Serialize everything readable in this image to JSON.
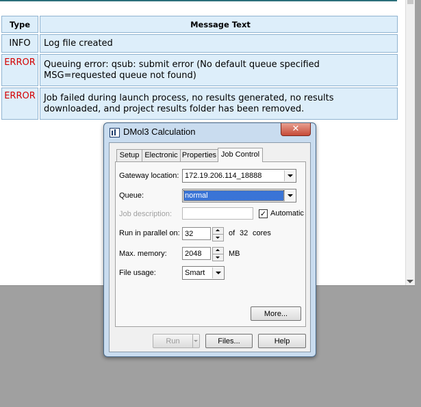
{
  "log": {
    "headers": {
      "type": "Type",
      "message": "Message Text"
    },
    "rows": [
      {
        "type": "INFO",
        "message": "Log file created"
      },
      {
        "type": "ERROR",
        "message_line1": "Queuing error: qsub: submit error (No default queue specified",
        "message_line2": "MSG=requested queue not found)"
      },
      {
        "type": "ERROR",
        "message_line1": "Job failed during launch process, no results generated, no results",
        "message_line2": "downloaded, and project results folder has been removed."
      }
    ],
    "colors": {
      "error": "#d40000",
      "cell_bg": "#ddeefa",
      "cell_border": "#8fb3d0"
    }
  },
  "dialog": {
    "title": "DMol3 Calculation",
    "close_label": "✕",
    "tabs": [
      "Setup",
      "Electronic",
      "Properties",
      "Job Control"
    ],
    "active_tab": "Job Control",
    "gateway": {
      "label": "Gateway location:",
      "value": "172.19.206.114_18888"
    },
    "queue": {
      "label": "Queue:",
      "value": "normal"
    },
    "job_description": {
      "label": "Job description:",
      "value": "",
      "automatic_label": "Automatic",
      "automatic_checked": "✓"
    },
    "parallel": {
      "label": "Run in parallel on:",
      "value": "32",
      "of_label": "of",
      "total": "32",
      "cores_label": "cores"
    },
    "memory": {
      "label": "Max. memory:",
      "value": "2048",
      "unit": "MB"
    },
    "file_usage": {
      "label": "File usage:",
      "value": "Smart"
    },
    "more_button": "More...",
    "run_button": "Run",
    "files_button": "Files...",
    "help_button": "Help",
    "colors": {
      "frame": "#c9dcef",
      "selection": "#3a74d6",
      "close": "#c64a38"
    }
  }
}
